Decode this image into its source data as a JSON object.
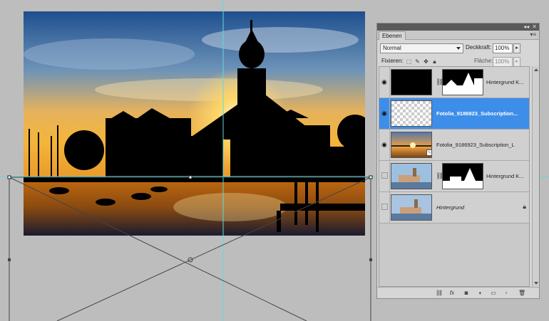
{
  "panel": {
    "tab_label": "Ebenen",
    "blend_mode": "Normal",
    "opacity_label": "Deckkraft:",
    "opacity_value": "100%",
    "lock_label": "Fixieren:",
    "fill_label": "Fläche:",
    "fill_value": "100%"
  },
  "layers": [
    {
      "name": "Hintergrund K...",
      "visible": true,
      "selected": false,
      "has_mask": true
    },
    {
      "name": "Fotolia_9186923_Subscription...",
      "visible": true,
      "selected": true,
      "has_mask": false
    },
    {
      "name": "Fotolia_9186923_Subscription_L",
      "visible": true,
      "selected": false,
      "has_mask": false
    },
    {
      "name": "Hintergrund K...",
      "visible": false,
      "selected": false,
      "has_mask": true
    },
    {
      "name": "Hintergrund",
      "visible": false,
      "selected": false,
      "has_mask": false,
      "locked": true
    }
  ],
  "colors": {
    "selection": "#3d8ee9",
    "guide": "#62d9dc",
    "canvas_bg": "#bdbdbd"
  }
}
